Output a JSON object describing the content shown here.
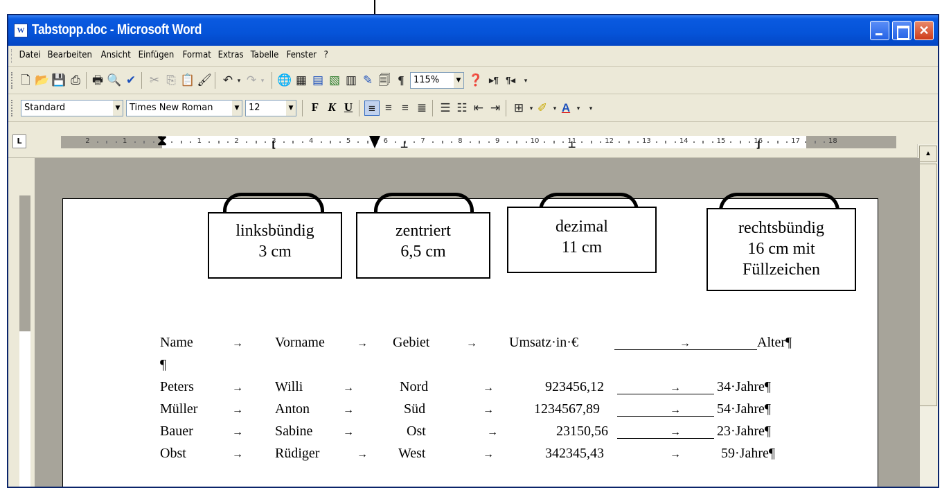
{
  "window": {
    "title": "Tabstopp.doc - Microsoft Word",
    "app_icon": "W"
  },
  "menubar": [
    "Datei",
    "Bearbeiten",
    "Ansicht",
    "Einfügen",
    "Format",
    "Extras",
    "Tabelle",
    "Fenster",
    "?"
  ],
  "toolbar_standard": {
    "zoom": "115%"
  },
  "toolbar_format": {
    "style": "Standard",
    "font": "Times New Roman",
    "size": "12",
    "bold": "F",
    "italic": "K",
    "underline": "U"
  },
  "ruler": {
    "tab_selector": "L",
    "numbers_left": [
      "2",
      "1"
    ],
    "numbers_right": [
      "1",
      "2",
      "3",
      "4",
      "5",
      "6",
      "7",
      "8",
      "9",
      "10",
      "11",
      "12",
      "13",
      "14",
      "15",
      "16",
      "17",
      "18"
    ]
  },
  "callouts": [
    {
      "line1": "linksbündig",
      "line2": "3 cm",
      "line3": ""
    },
    {
      "line1": "zentriert",
      "line2": "6,5 cm",
      "line3": ""
    },
    {
      "line1": "dezimal",
      "line2": "11 cm",
      "line3": ""
    },
    {
      "line1": "rechtsbündig",
      "line2": "16 cm mit",
      "line3": "Füllzeichen"
    }
  ],
  "document": {
    "header": {
      "name": "Name",
      "vorname": "Vorname",
      "gebiet": "Gebiet",
      "umsatz": "Umsatz·in·€",
      "alter": "Alter¶"
    },
    "empty_para": "¶",
    "arrow": "→",
    "rows": [
      {
        "name": "Peters",
        "vorname": "Willi",
        "gebiet": "Nord",
        "umsatz": "923456,12",
        "alter": "34·Jahre¶"
      },
      {
        "name": "Müller",
        "vorname": "Anton",
        "gebiet": "Süd",
        "umsatz": "1234567,89",
        "alter": "54·Jahre¶"
      },
      {
        "name": "Bauer",
        "vorname": "Sabine",
        "gebiet": "Ost",
        "umsatz": "23150,56",
        "alter": "23·Jahre¶"
      },
      {
        "name": "Obst",
        "vorname": "Rüdiger",
        "gebiet": "West",
        "umsatz": "342345,43",
        "alter": "59·Jahre¶"
      }
    ]
  }
}
